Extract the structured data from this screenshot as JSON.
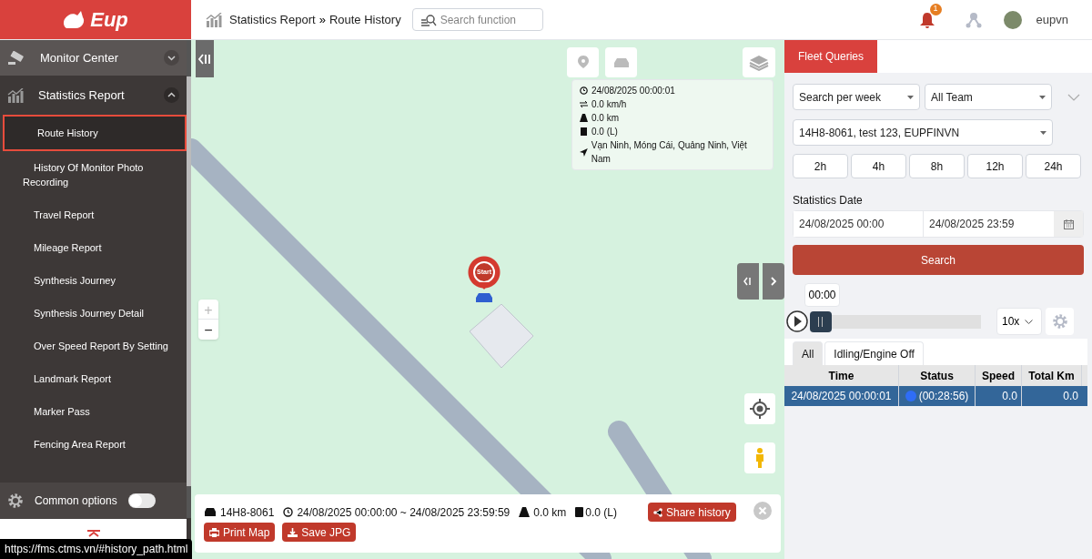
{
  "header": {
    "logo": "Eup",
    "breadcrumb": [
      "Statistics Report",
      "Route History"
    ],
    "breadcrumb_separator": "»",
    "search": {
      "placeholder": "Search function"
    },
    "notification_count": "1",
    "user": "eupvn"
  },
  "sidebar": {
    "sections": [
      {
        "label": "Monitor Center",
        "kind": "monitor",
        "expanded": false
      },
      {
        "label": "Statistics Report",
        "kind": "stats",
        "expanded": true,
        "children": [
          {
            "label": "Route History",
            "selected": true
          },
          {
            "label": "History Of Monitor Photo Recording",
            "selected": false
          },
          {
            "label": "Travel Report",
            "selected": false
          },
          {
            "label": "Mileage Report",
            "selected": false
          },
          {
            "label": "Synthesis Journey",
            "selected": false
          },
          {
            "label": "Synthesis Journey Detail",
            "selected": false
          },
          {
            "label": "Over Speed Report By Setting",
            "selected": false
          },
          {
            "label": "Landmark Report",
            "selected": false
          },
          {
            "label": "Marker Pass",
            "selected": false
          },
          {
            "label": "Fencing Area Report",
            "selected": false
          }
        ]
      }
    ],
    "common_options": {
      "label": "Common options",
      "on": false
    }
  },
  "map": {
    "info": {
      "time": "24/08/2025 00:00:01",
      "speed": "0.0 km/h",
      "distance": "0.0 km",
      "fuel": "0.0 (L)",
      "address": "Vạn Ninh, Móng Cái, Quảng Ninh, Việt Nam"
    },
    "marker_label": "Start",
    "zoom_in": "+",
    "zoom_out": "−",
    "summary": {
      "plate": "14H8-8061",
      "range": "24/08/2025 00:00:00 ~ 24/08/2025 23:59:59",
      "distance": "0.0 km",
      "fuel": "0.0 (L)",
      "buttons": [
        "Share history",
        "Print Map",
        "Save JPG"
      ]
    }
  },
  "panel": {
    "tabs": [
      {
        "label": "Fleet Queries",
        "selected": true
      }
    ],
    "period": "Search per week",
    "team": "All Team",
    "vehicle": "14H8-8061, test 123, EUPFINVN",
    "hours": [
      "2h",
      "4h",
      "8h",
      "12h",
      "24h"
    ],
    "date_label": "Statistics Date",
    "date_from": "24/08/2025 00:00",
    "date_to": "24/08/2025 23:59",
    "search_button": "Search",
    "playback": {
      "time": "00:00",
      "level": 0,
      "speed": "10x"
    },
    "filter_tabs": [
      {
        "label": "All",
        "selected": true
      },
      {
        "label": "Idling/Engine Off",
        "selected": false
      }
    ],
    "table": {
      "columns": [
        "Time",
        "Status",
        "Speed",
        "Total Km"
      ],
      "rows": [
        {
          "time": "24/08/2025 00:00:01",
          "status": "(00:28:56)",
          "color": "#2f6df6",
          "speed": "0.0",
          "total_km": "0.0",
          "selected": true
        }
      ]
    }
  },
  "status_url": "https://fms.ctms.vn/#history_path.html"
}
